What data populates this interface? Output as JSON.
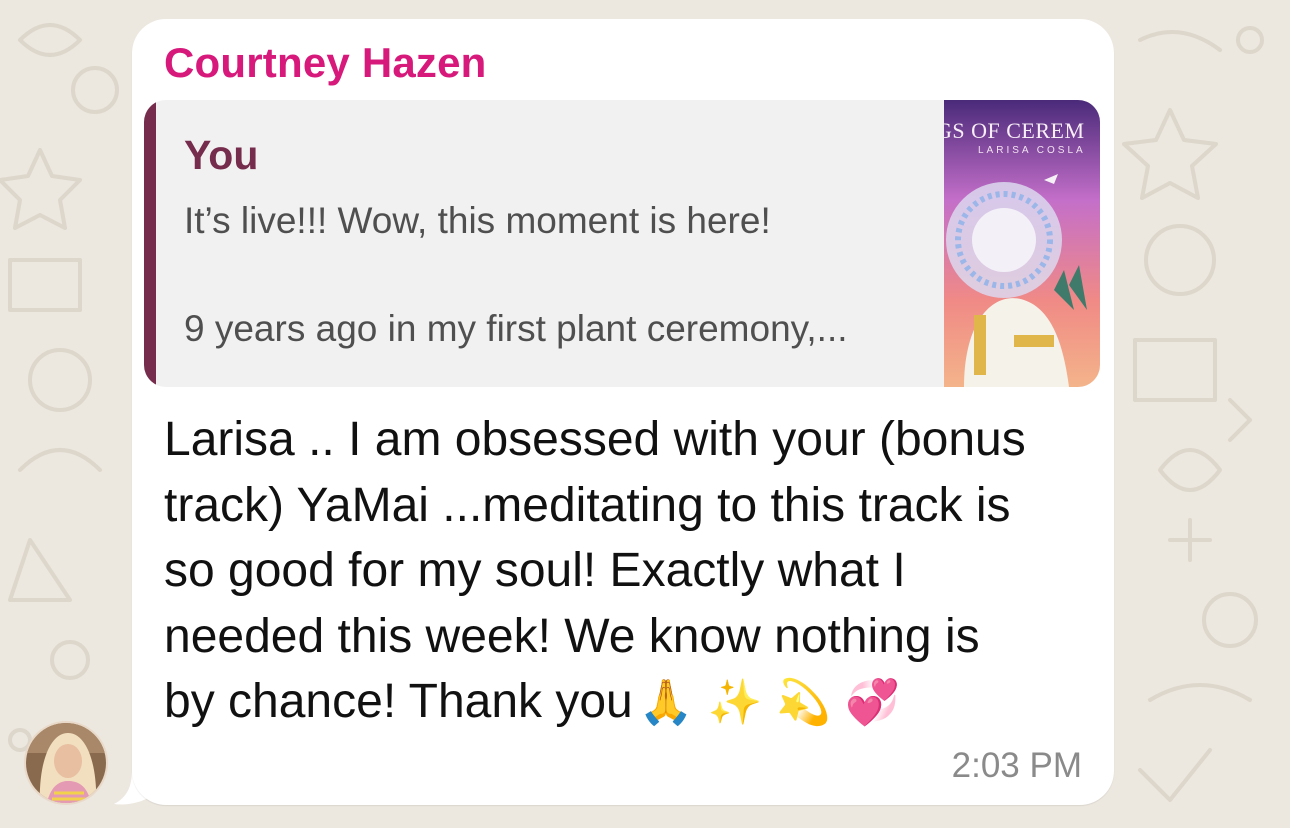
{
  "message": {
    "sender": "Courtney Hazen",
    "quoted": {
      "author": "You",
      "line1": "It’s live!!! Wow, this moment is here!",
      "line2": "9 years ago in my first plant ceremony,...",
      "thumbnail": {
        "title": "GS OF CEREM",
        "artist": "LARISA COSLA"
      }
    },
    "body_lines": [
      "Larisa .. I am obsessed with your (bonus",
      "track) YaMai ...meditating to this track is",
      "so good for my soul! Exactly what I",
      "needed this week! We know nothing is",
      "by chance! Thank you"
    ],
    "emojis": [
      "🙏",
      "✨",
      "💫",
      "💞"
    ],
    "time": "2:03 PM"
  },
  "icons": {
    "avatar": "user-avatar",
    "emoji_icons": [
      "folded-hands-icon",
      "sparkles-icon",
      "dizzy-icon",
      "revolving-hearts-icon"
    ]
  },
  "colors": {
    "background": "#ece7df",
    "bubble": "#ffffff",
    "sender_name": "#d6197b",
    "quote_bar": "#762c4c",
    "quote_author": "#762c4c",
    "quote_bg": "#f1f1f1",
    "time": "#8a8a8a"
  }
}
